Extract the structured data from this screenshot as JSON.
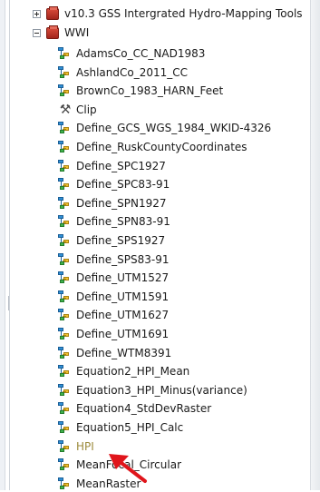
{
  "tree": {
    "toolboxes": [
      {
        "label": "v10.3 GSS Intergrated Hydro-Mapping Tools",
        "expander": "plus",
        "icon": "toolbox-icon"
      },
      {
        "label": "WWI",
        "expander": "minus",
        "icon": "toolbox-icon"
      }
    ],
    "tools": [
      {
        "label": "AdamsCo_CC_NAD1983",
        "icon": "model-icon"
      },
      {
        "label": "AshlandCo_2011_CC",
        "icon": "model-icon"
      },
      {
        "label": "BrownCo_1983_HARN_Feet",
        "icon": "model-icon"
      },
      {
        "label": "Clip",
        "icon": "hammer-icon"
      },
      {
        "label": "Define_GCS_WGS_1984_WKID-4326",
        "icon": "model-icon"
      },
      {
        "label": "Define_RuskCountyCoordinates",
        "icon": "model-icon"
      },
      {
        "label": "Define_SPC1927",
        "icon": "model-icon"
      },
      {
        "label": "Define_SPC83-91",
        "icon": "model-icon"
      },
      {
        "label": "Define_SPN1927",
        "icon": "model-icon"
      },
      {
        "label": "Define_SPN83-91",
        "icon": "model-icon"
      },
      {
        "label": "Define_SPS1927",
        "icon": "model-icon"
      },
      {
        "label": "Define_SPS83-91",
        "icon": "model-icon"
      },
      {
        "label": "Define_UTM1527",
        "icon": "model-icon"
      },
      {
        "label": "Define_UTM1591",
        "icon": "model-icon"
      },
      {
        "label": "Define_UTM1627",
        "icon": "model-icon"
      },
      {
        "label": "Define_UTM1691",
        "icon": "model-icon"
      },
      {
        "label": "Define_WTM8391",
        "icon": "model-icon"
      },
      {
        "label": "Equation2_HPI_Mean",
        "icon": "model-icon"
      },
      {
        "label": "Equation3_HPI_Minus(variance)",
        "icon": "model-icon"
      },
      {
        "label": "Equation4_StdDevRaster",
        "icon": "model-icon"
      },
      {
        "label": "Equation5_HPI_Calc",
        "icon": "model-icon"
      },
      {
        "label": "HPI",
        "icon": "model-icon"
      },
      {
        "label": "MeanFocal_Circular",
        "icon": "model-icon"
      },
      {
        "label": "MeanRaster",
        "icon": "model-icon"
      }
    ]
  },
  "colors": {
    "highlight_label": "#9c8a3b",
    "annotation_arrow": "#e0151b"
  }
}
